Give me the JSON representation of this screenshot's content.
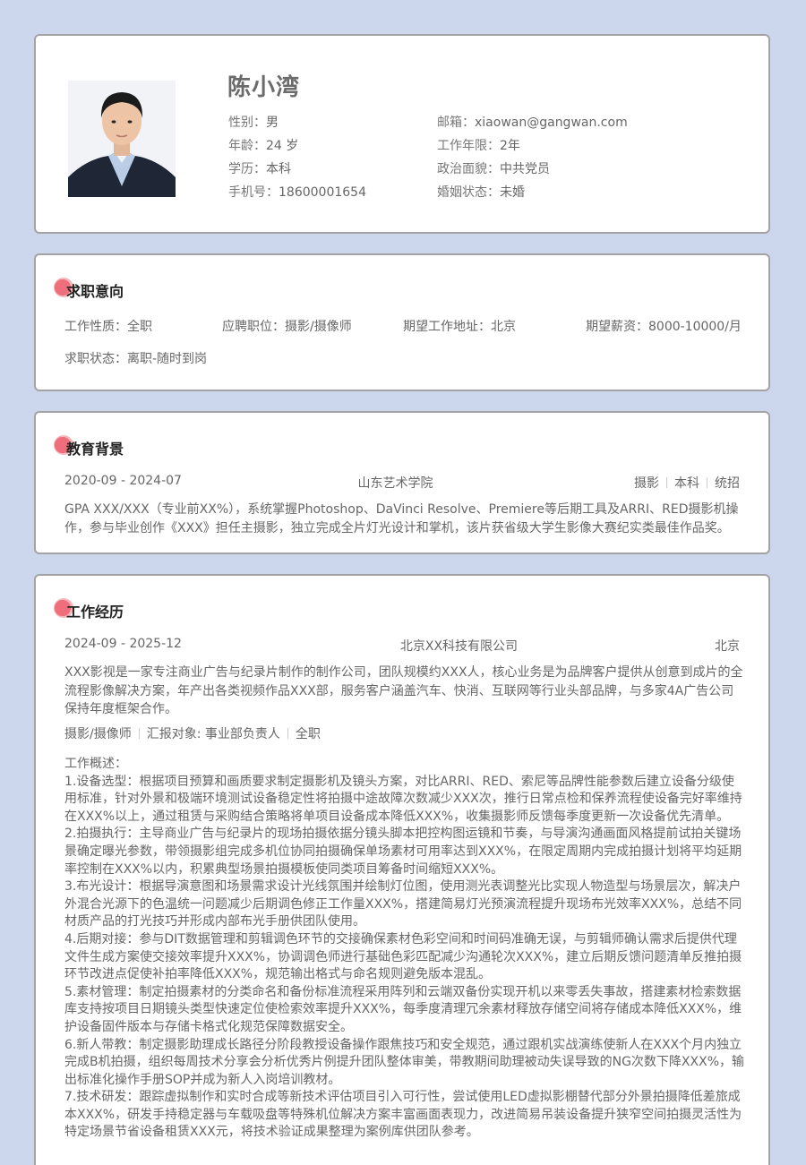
{
  "profile": {
    "name": "陈小湾",
    "gender_label": "性别：",
    "gender": "男",
    "age_label": "年龄：",
    "age": "24 岁",
    "degree_label": "学历：",
    "degree": "本科",
    "phone_label": "手机号：",
    "phone": "18600001654",
    "email_label": "邮箱：",
    "email": "xiaowan@gangwan.com",
    "years_label": "工作年限：",
    "years": "2年",
    "politics_label": "政治面貌：",
    "politics": "中共党员",
    "marital_label": "婚姻状态：",
    "marital": "未婚"
  },
  "intent": {
    "title": "求职意向",
    "type_label": "工作性质：",
    "type": "全职",
    "position_label": "应聘职位：",
    "position": "摄影/摄像师",
    "location_label": "期望工作地址：",
    "location": "北京",
    "salary_label": "期望薪资：",
    "salary": "8000-10000/月",
    "status_label": "求职状态：",
    "status": "离职-随时到岗"
  },
  "education": {
    "title": "教育背景",
    "period": "2020-09 - 2024-07",
    "school": "山东艺术学院",
    "tags": [
      "摄影",
      "本科",
      "统招"
    ],
    "description": "GPA XXX/XXX（专业前XX%），系统掌握Photoshop、DaVinci Resolve、Premiere等后期工具及ARRI、RED摄影机操作，参与毕业创作《XXX》担任主摄影，独立完成全片灯光设计和掌机，该片获省级大学生影像大赛纪实类最佳作品奖。"
  },
  "work": {
    "title": "工作经历",
    "period": "2024-09 - 2025-12",
    "company": "北京XX科技有限公司",
    "city": "北京",
    "company_desc": "XXX影视是一家专注商业广告与纪录片制作的制作公司，团队规模约XXX人，核心业务是为品牌客户提供从创意到成片的全流程影像解决方案，年产出各类视频作品XXX部，服务客户涵盖汽车、快消、互联网等行业头部品牌，与多家4A广告公司保持年度框架合作。",
    "tags": [
      "摄影/摄像师",
      "汇报对象: 事业部负责人",
      "全职"
    ],
    "overview_label": "工作概述：",
    "items": [
      "1.设备选型：根据项目预算和画质要求制定摄影机及镜头方案，对比ARRI、RED、索尼等品牌性能参数后建立设备分级使用标准，针对外景和极端环境测试设备稳定性将拍摄中途故障次数减少XXX次，推行日常点检和保养流程使设备完好率维持在XXX%以上，通过租赁与采购结合策略将单项目设备成本降低XXX%，收集摄影师反馈每季度更新一次设备优先清单。",
      "2.拍摄执行：主导商业广告与纪录片的现场拍摄依据分镜头脚本把控构图运镜和节奏，与导演沟通画面风格提前试拍关键场景确定曝光参数，带领摄影组完成多机位协同拍摄确保单场素材可用率达到XXX%，在限定周期内完成拍摄计划将平均延期率控制在XXX%以内，积累典型场景拍摄模板使同类项目筹备时间缩短XXX%。",
      "3.布光设计：根据导演意图和场景需求设计光线氛围并绘制灯位图，使用测光表调整光比实现人物造型与场景层次，解决户外混合光源下的色温统一问题减少后期调色修正工作量XXX%，搭建简易灯光预演流程提升现场布光效率XXX%，总结不同材质产品的打光技巧并形成内部布光手册供团队使用。",
      "4.后期对接：参与DIT数据管理和剪辑调色环节的交接确保素材色彩空间和时间码准确无误，与剪辑师确认需求后提供代理文件生成方案使交接效率提升XXX%，协调调色师进行基础色彩匹配减少沟通轮次XXX%，建立后期反馈问题清单反推拍摄环节改进点促使补拍率降低XXX%，规范输出格式与命名规则避免版本混乱。",
      "5.素材管理：制定拍摄素材的分类命名和备份标准流程采用阵列和云端双备份实现开机以来零丢失事故，搭建素材检索数据库支持按项目日期镜头类型快速定位使检索效率提升XXX%，每季度清理冗余素材释放存储空间将存储成本降低XXX%，维护设备固件版本与存储卡格式化规范保障数据安全。",
      "6.新人带教：制定摄影助理成长路径分阶段教授设备操作跟焦技巧和安全规范，通过跟机实战演练使新人在XXX个月内独立完成B机拍摄，组织每周技术分享会分析优秀片例提升团队整体审美，带教期间助理被动失误导致的NG次数下降XXX%，输出标准化操作手册SOP并成为新人入岗培训教材。",
      "7.技术研发：跟踪虚拟制作和实时合成等新技术评估项目引入可行性，尝试使用LED虚拟影棚替代部分外景拍摄降低差旅成本XXX%，研发手持稳定器与车载吸盘等特殊机位解决方案丰富画面表现力，改进简易吊装设备提升狭窄空间拍摄灵活性为特定场景节省设备租赁XXX元，将技术验证成果整理为案例库供团队参考。"
    ]
  }
}
